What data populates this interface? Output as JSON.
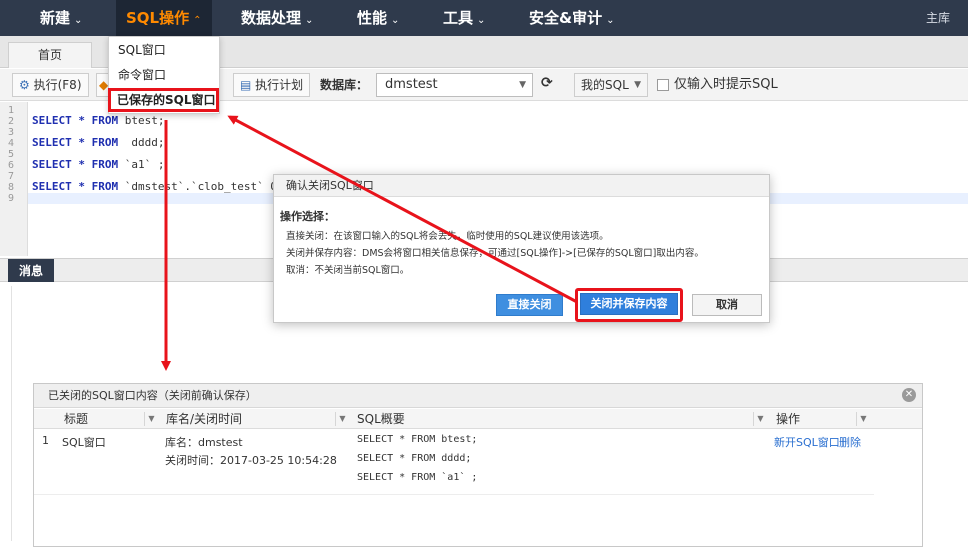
{
  "topnav": {
    "items": [
      {
        "label": "新建"
      },
      {
        "label": "SQL操作"
      },
      {
        "label": "数据处理"
      },
      {
        "label": "性能"
      },
      {
        "label": "工具"
      },
      {
        "label": "安全&审计"
      }
    ],
    "right_label": "主库",
    "active_color": "#ff8a00"
  },
  "dropdown": {
    "items": [
      {
        "label": "SQL窗口"
      },
      {
        "label": "命令窗口"
      },
      {
        "label": "已保存的SQL窗口"
      }
    ]
  },
  "tabs": {
    "home": "首页"
  },
  "toolbar": {
    "execute": "执行(F8)",
    "plan": "执行计划",
    "db_label": "数据库：",
    "db_value": "dmstest",
    "mysql": "我的SQL",
    "hint_checkbox": "仅输入时提示SQL"
  },
  "editor": {
    "line_numbers": [
      "1",
      "2",
      "3",
      "4",
      "5",
      "6",
      "7",
      "8",
      "9"
    ],
    "lines": [
      {
        "kw": "SELECT * FROM",
        "rest": " btest;"
      },
      {
        "kw": "SELECT * FROM",
        "rest": "  dddd;"
      },
      {
        "kw": "SELECT * FROM",
        "rest": " `a1` ;"
      },
      {
        "kw": "SELECT * FROM",
        "rest": " `dmstest`.`clob_test` ORI"
      }
    ]
  },
  "messages": {
    "tab": "消息"
  },
  "dialog": {
    "title": "确认关闭SQL窗口",
    "heading": "操作选择：",
    "lines": [
      "直接关闭：在该窗口输入的SQL将会丢失，临时使用的SQL建议使用该选项。",
      "关闭并保存内容：DMS会将窗口相关信息保存，可通过[SQL操作]->[已保存的SQL窗口]取出内容。",
      "取消：不关闭当前SQL窗口。"
    ],
    "btn_direct": "直接关闭",
    "btn_save": "关闭并保存内容",
    "btn_cancel": "取消",
    "primary_color": "#2f7fdc"
  },
  "closed_panel": {
    "title": "已关闭的SQL窗口内容（关闭前确认保存）",
    "columns": [
      "标题",
      "库名/关闭时间",
      "SQL概要",
      "操作"
    ],
    "rows": [
      {
        "index": "1",
        "title": "SQL窗口",
        "db": "库名：dmstest",
        "time": "关闭时间：2017-03-25 10:54:28",
        "sql": [
          "SELECT * FROM btest;",
          "SELECT * FROM  dddd;",
          "SELECT * FROM `a1` ;"
        ],
        "action_open": "新开SQL窗口",
        "action_delete": "删除"
      }
    ]
  },
  "annotation_color": "#e8131b"
}
